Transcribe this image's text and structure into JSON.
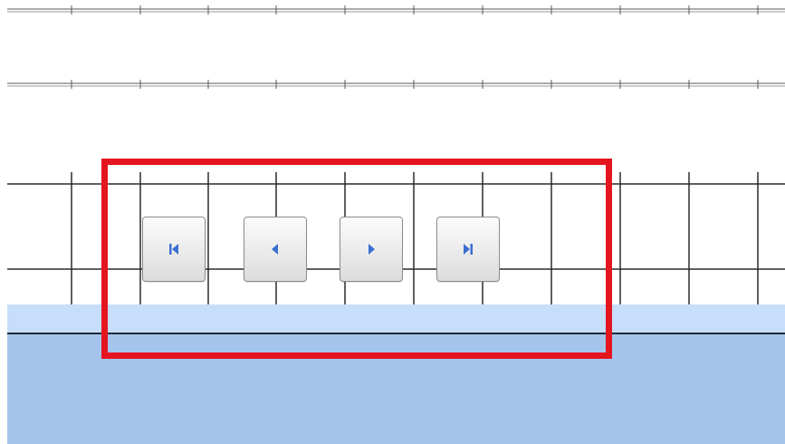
{
  "toolbar": {
    "buttons": [
      {
        "id": "first",
        "icon": "first-record-icon"
      },
      {
        "id": "prev",
        "icon": "previous-record-icon"
      },
      {
        "id": "next",
        "icon": "next-record-icon"
      },
      {
        "id": "last",
        "icon": "last-record-icon"
      }
    ]
  },
  "colors": {
    "highlight": "#e4151f",
    "icon_blue": "#3b6fd1",
    "band_light": "#c7defa",
    "band_dark": "#a5c4eb",
    "grid_line": "#2b2b2b"
  }
}
